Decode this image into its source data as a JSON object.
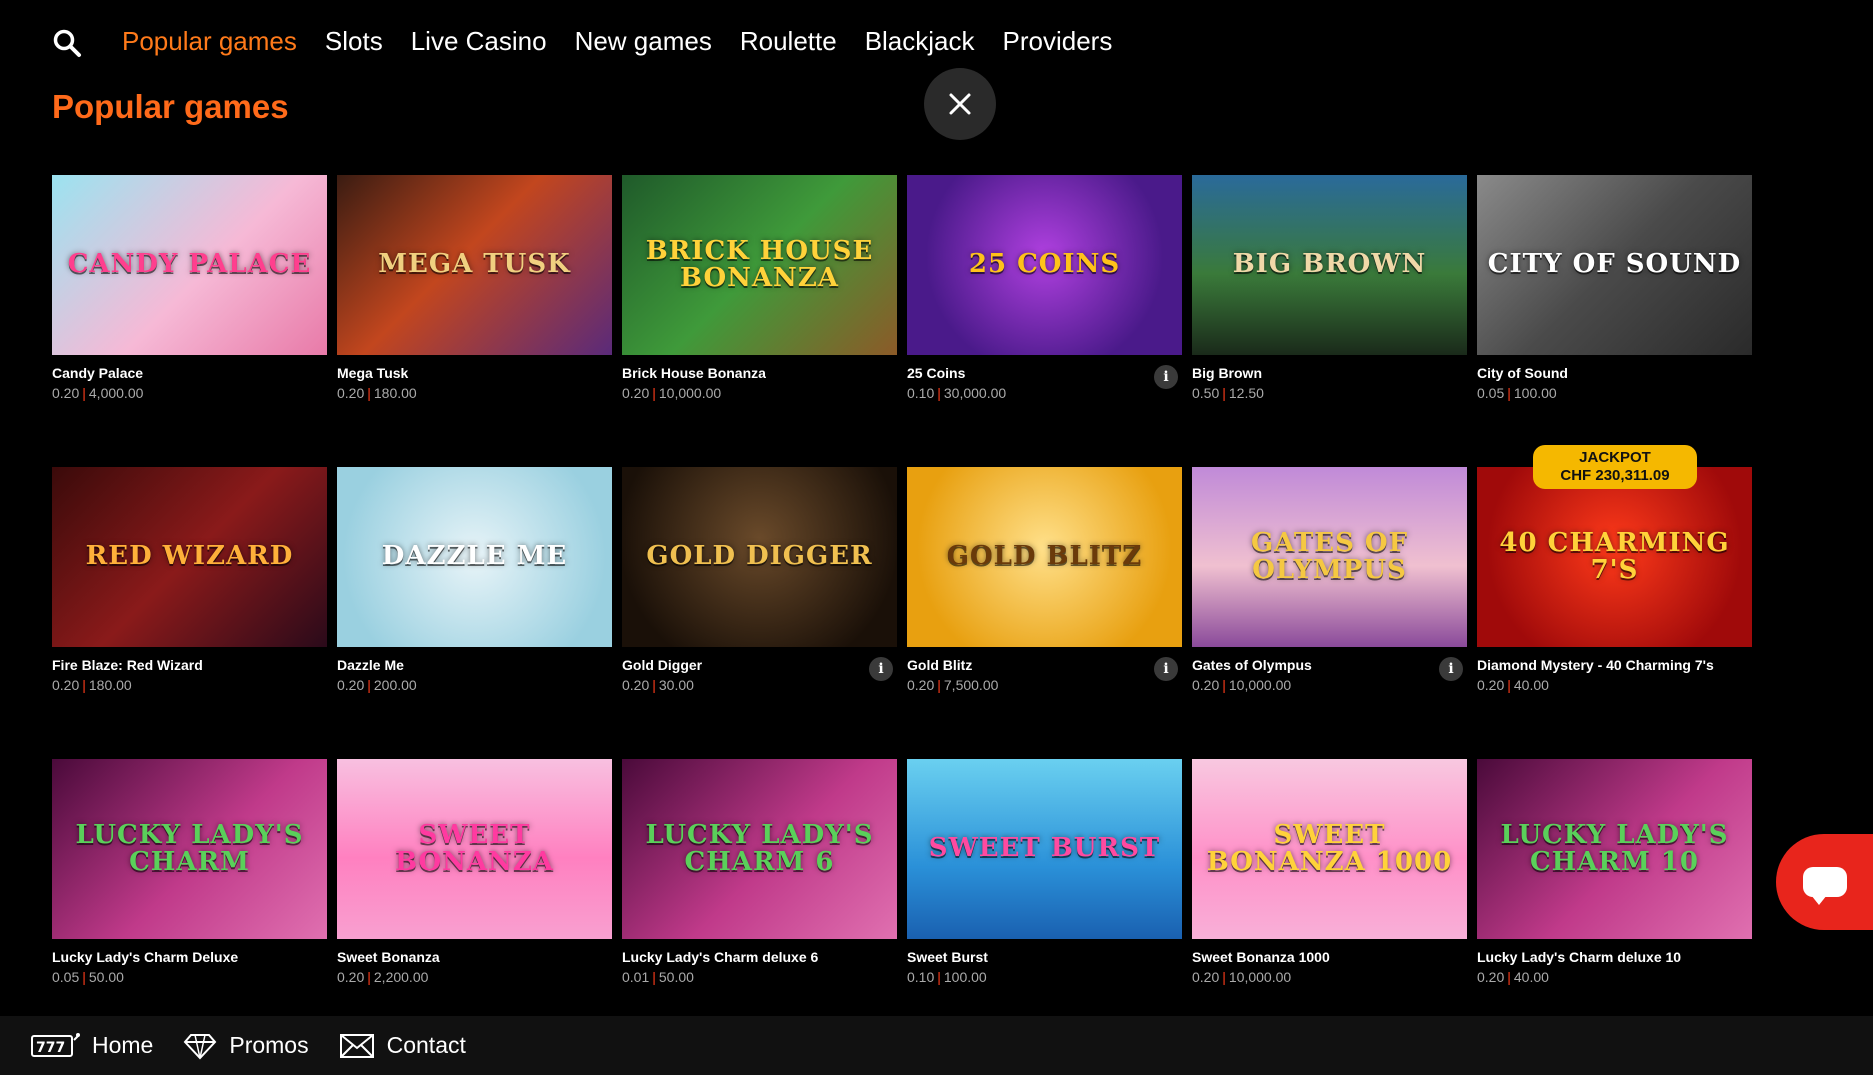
{
  "nav": {
    "search_icon": "search-icon",
    "tabs": [
      {
        "label": "Popular games",
        "active": true
      },
      {
        "label": "Slots",
        "active": false
      },
      {
        "label": "Live Casino",
        "active": false
      },
      {
        "label": "New games",
        "active": false
      },
      {
        "label": "Roulette",
        "active": false
      },
      {
        "label": "Blackjack",
        "active": false
      },
      {
        "label": "Providers",
        "active": false
      }
    ]
  },
  "section": {
    "title": "Popular games"
  },
  "colors": {
    "accent": "#ff7a1a",
    "stake_separator": "#ff3b1a",
    "chat": "#e8251c",
    "jackpot": "#f5b800"
  },
  "games": [
    {
      "name": "Candy Palace",
      "min": "0.20",
      "max": "4,000.00",
      "art": "CANDY PALACE",
      "bg": "linear-gradient(135deg,#9be3f0,#f6b9d6 55%,#e87aa8)",
      "fg": "#ff3f8e",
      "info": false
    },
    {
      "name": "Mega Tusk",
      "min": "0.20",
      "max": "180.00",
      "art": "MEGA TUSK",
      "bg": "linear-gradient(135deg,#3a1c12,#c2461e 45%,#5a2a7a)",
      "fg": "#f0d080",
      "info": false
    },
    {
      "name": "Brick House Bonanza",
      "min": "0.20",
      "max": "10,000.00",
      "art": "BRICK HOUSE BONANZA",
      "bg": "linear-gradient(135deg,#1f5a2a,#3f9a3a 50%,#8c5a28)",
      "fg": "#ffd23a",
      "info": false
    },
    {
      "name": "25 Coins",
      "min": "0.10",
      "max": "30,000.00",
      "art": "25 COINS",
      "bg": "radial-gradient(circle at 50% 45%,#b040e0,#4a1a8a 70%)",
      "fg": "#ffc21a",
      "info": true
    },
    {
      "name": "Big Brown",
      "min": "0.50",
      "max": "12.50",
      "art": "BIG BROWN",
      "bg": "linear-gradient(180deg,#2a6a9a,#3a7a3a 55%,#1a2a1a)",
      "fg": "#f0d8a8",
      "info": false
    },
    {
      "name": "City of Sound",
      "min": "0.05",
      "max": "100.00",
      "art": "city of sound",
      "bg": "linear-gradient(135deg,#8a8a8a,#4a4a4a 50%,#2a2a2a)",
      "fg": "#ffffff",
      "info": false
    },
    {
      "name": "Fire Blaze: Red Wizard",
      "min": "0.20",
      "max": "180.00",
      "art": "RED WIZARD",
      "bg": "linear-gradient(135deg,#3a0a0a,#8a1a1a 50%,#2a0a1a)",
      "fg": "#ffb03a",
      "info": false
    },
    {
      "name": "Dazzle Me",
      "min": "0.20",
      "max": "200.00",
      "art": "Dazzle Me",
      "bg": "radial-gradient(circle at 50% 50%,#e8f4f8,#9ad0e0 80%)",
      "fg": "#ffffff",
      "info": false
    },
    {
      "name": "Gold Digger",
      "min": "0.20",
      "max": "30.00",
      "art": "GOLD DIGGER",
      "bg": "radial-gradient(circle at 50% 40%,#6a4a2a,#1a1008 80%)",
      "fg": "#f0c050",
      "info": true
    },
    {
      "name": "Gold Blitz",
      "min": "0.20",
      "max": "7,500.00",
      "art": "GOLD BLITZ",
      "bg": "radial-gradient(circle at 50% 45%,#ffe08a,#e8a010 75%)",
      "fg": "#6a3a0a",
      "info": true
    },
    {
      "name": "Gates of Olympus",
      "min": "0.20",
      "max": "10,000.00",
      "art": "GATES of OLYMPUS",
      "bg": "linear-gradient(180deg,#c08ad8,#f0c0d0 55%,#8a4a9a)",
      "fg": "#f5c842",
      "info": true
    },
    {
      "name": "Diamond Mystery - 40 Charming 7's",
      "min": "0.20",
      "max": "40.00",
      "art": "40 CHARMING 7'S",
      "bg": "radial-gradient(circle at 50% 45%,#ff3a1a,#a00a0a 75%)",
      "fg": "#ffd23a",
      "info": false,
      "jackpot": {
        "label": "JACKPOT",
        "amount": "CHF 230,311.09"
      }
    },
    {
      "name": "Lucky Lady's Charm Deluxe",
      "min": "0.05",
      "max": "50.00",
      "art": "Lucky Lady's Charm",
      "bg": "linear-gradient(135deg,#4a0a3a,#c03a8a 55%,#e070b0)",
      "fg": "#5ad05a",
      "info": false
    },
    {
      "name": "Sweet Bonanza",
      "min": "0.20",
      "max": "2,200.00",
      "art": "SWEET BONANZA",
      "bg": "linear-gradient(180deg,#f8c0e0,#ff80c0 55%,#f8a0d0)",
      "fg": "#ff3aa0",
      "info": false
    },
    {
      "name": "Lucky Lady's Charm deluxe 6",
      "min": "0.01",
      "max": "50.00",
      "art": "Lucky Lady's Charm 6",
      "bg": "linear-gradient(135deg,#4a0a3a,#c03a8a 55%,#e070b0)",
      "fg": "#5ad05a",
      "info": false
    },
    {
      "name": "Sweet Burst",
      "min": "0.10",
      "max": "100.00",
      "art": "Sweet BURST",
      "bg": "linear-gradient(180deg,#6ad0f0,#2a90d8 60%,#1a60b0)",
      "fg": "#ff4aa0",
      "info": false
    },
    {
      "name": "Sweet Bonanza 1000",
      "min": "0.20",
      "max": "10,000.00",
      "art": "SWEET BONANZA 1000",
      "bg": "linear-gradient(180deg,#f8c8e0,#ff90c8 55%,#f8b0d8)",
      "fg": "#ffd23a",
      "info": false
    },
    {
      "name": "Lucky Lady's Charm deluxe 10",
      "min": "0.20",
      "max": "40.00",
      "art": "Lucky Lady's Charm 10",
      "bg": "linear-gradient(135deg,#4a0a3a,#c03a8a 55%,#e070b0)",
      "fg": "#5ad05a",
      "info": false
    }
  ],
  "info_glyph": "i",
  "close_icon": "close-icon",
  "chat_icon": "chat-icon",
  "bottom_nav": [
    {
      "label": "Home",
      "icon": "slot-777-icon"
    },
    {
      "label": "Promos",
      "icon": "diamond-icon"
    },
    {
      "label": "Contact",
      "icon": "envelope-icon"
    }
  ]
}
